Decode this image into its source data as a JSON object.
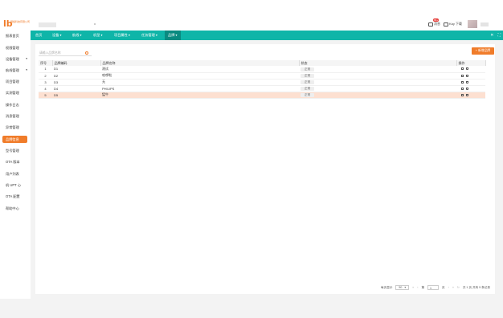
{
  "brand": {
    "logo_mark": "lb",
    "logo_text": "网络科技有限公司"
  },
  "topbar": {
    "messages_label": "消息",
    "messages_badge": "99+",
    "account_label": "Kay 下载"
  },
  "sidebar": {
    "items": [
      {
        "label": "报表首页",
        "arrow": ""
      },
      {
        "label": "权限管理",
        "arrow": ""
      },
      {
        "label": "设备管理",
        "arrow": "▾"
      },
      {
        "label": "航线管理",
        "arrow": "▾"
      },
      {
        "label": "项目管理",
        "arrow": ""
      },
      {
        "label": "实测管理",
        "arrow": ""
      },
      {
        "label": "操作日志",
        "arrow": ""
      },
      {
        "label": "消息管理",
        "arrow": ""
      },
      {
        "label": "异常管理",
        "arrow": ""
      },
      {
        "label": "品牌信息",
        "arrow": ""
      },
      {
        "label": "型号管理",
        "arrow": ""
      },
      {
        "label": "OTA 版本",
        "arrow": ""
      },
      {
        "label": "用户列表",
        "arrow": ""
      },
      {
        "label": "机 UPT 心",
        "arrow": ""
      },
      {
        "label": "OTA 配置",
        "arrow": ""
      },
      {
        "label": "帮助中心",
        "arrow": ""
      }
    ],
    "active_index": 9
  },
  "tabs": {
    "items": [
      {
        "label": "首页"
      },
      {
        "label": "设备 ▾"
      },
      {
        "label": "航线 ▾"
      },
      {
        "label": "机型 ▾"
      },
      {
        "label": "项目属性 ▾"
      },
      {
        "label": "任务管理 ▾"
      },
      {
        "label": "品牌 ▾"
      }
    ],
    "close_icon": "✕",
    "expand_icon": "⛶"
  },
  "toolbar": {
    "search_placeholder": "请输入品牌名称",
    "add_button": "+ 新增品牌"
  },
  "table": {
    "headers": [
      "序号",
      "品牌编码",
      "品牌名称",
      "状态",
      "操作"
    ],
    "rows": [
      {
        "index": "1",
        "code": "D1",
        "name": "测试",
        "status": "正常"
      },
      {
        "index": "2",
        "code": "D2",
        "name": "哈啰啦",
        "status": "正常"
      },
      {
        "index": "3",
        "code": "D3",
        "name": "无",
        "status": "正常"
      },
      {
        "index": "4",
        "code": "D4",
        "name": "PHILIPS",
        "status": "正常"
      },
      {
        "index": "5",
        "code": "D5",
        "name": "猛牛",
        "status": "正常"
      }
    ],
    "highlight_row": 4
  },
  "pagination": {
    "per_page_label": "每页显示",
    "per_page": "50",
    "page_prefix": "第",
    "current_page": "1",
    "page_suffix": "页",
    "total_text": "共 1 页 共有 5 条记录"
  },
  "colors": {
    "accent": "#f07c2a",
    "tab_bar": "#0fb5a8",
    "highlight": "#fde0d1"
  }
}
